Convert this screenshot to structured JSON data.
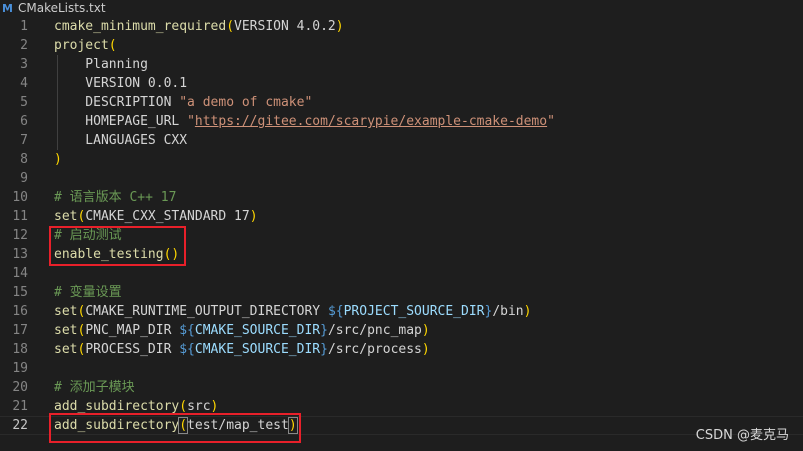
{
  "tab": {
    "icon_letter": "M",
    "filename": "CMakeLists.txt"
  },
  "lines": [
    {
      "n": "1",
      "tokens": [
        [
          "fn",
          "cmake_minimum_required"
        ],
        [
          "par",
          "("
        ],
        [
          "plain",
          "VERSION 4.0.2"
        ],
        [
          "par",
          ")"
        ]
      ]
    },
    {
      "n": "2",
      "tokens": [
        [
          "fn",
          "project"
        ],
        [
          "par",
          "("
        ]
      ]
    },
    {
      "n": "3",
      "tokens": [
        [
          "plain",
          "    Planning"
        ]
      ]
    },
    {
      "n": "4",
      "tokens": [
        [
          "plain",
          "    VERSION 0.0.1"
        ]
      ]
    },
    {
      "n": "5",
      "tokens": [
        [
          "plain",
          "    DESCRIPTION "
        ],
        [
          "str",
          "\"a demo of cmake\""
        ]
      ]
    },
    {
      "n": "6",
      "tokens": [
        [
          "plain",
          "    HOMEPAGE_URL "
        ],
        [
          "str",
          "\""
        ],
        [
          "url",
          "https://gitee.com/scarypie/example-cmake-demo"
        ],
        [
          "str",
          "\""
        ]
      ]
    },
    {
      "n": "7",
      "tokens": [
        [
          "plain",
          "    LANGUAGES CXX"
        ]
      ]
    },
    {
      "n": "8",
      "tokens": [
        [
          "par",
          ")"
        ]
      ]
    },
    {
      "n": "9",
      "tokens": []
    },
    {
      "n": "10",
      "tokens": [
        [
          "cmt",
          "# 语言版本 C++ 17"
        ]
      ]
    },
    {
      "n": "11",
      "tokens": [
        [
          "fn",
          "set"
        ],
        [
          "par",
          "("
        ],
        [
          "plain",
          "CMAKE_CXX_STANDARD 17"
        ],
        [
          "par",
          ")"
        ]
      ]
    },
    {
      "n": "12",
      "tokens": [
        [
          "cmt",
          "# 启动测试"
        ]
      ]
    },
    {
      "n": "13",
      "tokens": [
        [
          "fn",
          "enable_testing"
        ],
        [
          "par",
          "()"
        ]
      ]
    },
    {
      "n": "14",
      "tokens": []
    },
    {
      "n": "15",
      "tokens": [
        [
          "cmt",
          "# 变量设置"
        ]
      ]
    },
    {
      "n": "16",
      "tokens": [
        [
          "fn",
          "set"
        ],
        [
          "par",
          "("
        ],
        [
          "plain",
          "CMAKE_RUNTIME_OUTPUT_DIRECTORY "
        ],
        [
          "varu",
          "${"
        ],
        [
          "var",
          "PROJECT_SOURCE_DIR"
        ],
        [
          "varu",
          "}"
        ],
        [
          "plain",
          "/bin"
        ],
        [
          "par",
          ")"
        ]
      ]
    },
    {
      "n": "17",
      "tokens": [
        [
          "fn",
          "set"
        ],
        [
          "par",
          "("
        ],
        [
          "plain",
          "PNC_MAP_DIR "
        ],
        [
          "varu",
          "${"
        ],
        [
          "var",
          "CMAKE_SOURCE_DIR"
        ],
        [
          "varu",
          "}"
        ],
        [
          "plain",
          "/src/pnc_map"
        ],
        [
          "par",
          ")"
        ]
      ]
    },
    {
      "n": "18",
      "tokens": [
        [
          "fn",
          "set"
        ],
        [
          "par",
          "("
        ],
        [
          "plain",
          "PROCESS_DIR "
        ],
        [
          "varu",
          "${"
        ],
        [
          "var",
          "CMAKE_SOURCE_DIR"
        ],
        [
          "varu",
          "}"
        ],
        [
          "plain",
          "/src/process"
        ],
        [
          "par",
          ")"
        ]
      ]
    },
    {
      "n": "19",
      "tokens": []
    },
    {
      "n": "20",
      "tokens": [
        [
          "cmt",
          "# 添加子模块"
        ]
      ]
    },
    {
      "n": "21",
      "tokens": [
        [
          "fn",
          "add_subdirectory"
        ],
        [
          "par",
          "("
        ],
        [
          "plain",
          "src"
        ],
        [
          "par",
          ")"
        ]
      ]
    },
    {
      "n": "22",
      "tokens": [
        [
          "fn",
          "add_subdirectory"
        ],
        [
          "par",
          "("
        ],
        [
          "plain",
          "test/map_test"
        ],
        [
          "par",
          ")"
        ]
      ],
      "current": true
    }
  ],
  "watermark": "CSDN @麦克马",
  "colors": {
    "background": "#1e1e1e",
    "highlight_box": "#e8202a",
    "function": "#dcdcaa",
    "comment": "#6a9955",
    "string": "#ce9178",
    "bracket": "#ffd700",
    "variable": "#9cdcfe"
  }
}
